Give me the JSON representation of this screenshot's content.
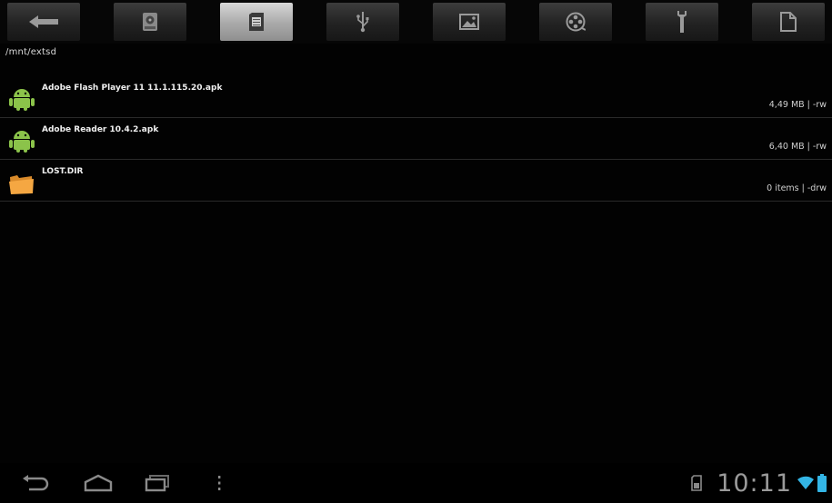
{
  "toolbar": {
    "buttons": [
      {
        "name": "back-arrow-icon",
        "active": false
      },
      {
        "name": "storage-icon",
        "active": false
      },
      {
        "name": "sd-card-icon",
        "active": true
      },
      {
        "name": "usb-icon",
        "active": false
      },
      {
        "name": "image-icon",
        "active": false
      },
      {
        "name": "video-reel-icon",
        "active": false
      },
      {
        "name": "tools-icon",
        "active": false
      },
      {
        "name": "document-icon",
        "active": false
      }
    ]
  },
  "path": "/mnt/extsd",
  "files": [
    {
      "name": "Adobe Flash Player 11 11.1.115.20.apk",
      "meta": "4,49 MB | -rw",
      "icon": "android-icon"
    },
    {
      "name": "Adobe Reader 10.4.2.apk",
      "meta": "6,40 MB | -rw",
      "icon": "android-icon"
    },
    {
      "name": "LOST.DIR",
      "meta": "0 items | -drw",
      "icon": "folder-icon"
    }
  ],
  "status_bar": {
    "clock": "10:11",
    "icons": [
      "sd-card-status-icon",
      "wifi-icon",
      "battery-icon"
    ]
  },
  "nav": [
    "back-nav-icon",
    "home-nav-icon",
    "recent-apps-icon",
    "menu-dots-icon"
  ],
  "colors": {
    "android_green": "#8bc34a",
    "folder_orange": "#f5a742",
    "wifi_blue": "#33b5e5"
  }
}
